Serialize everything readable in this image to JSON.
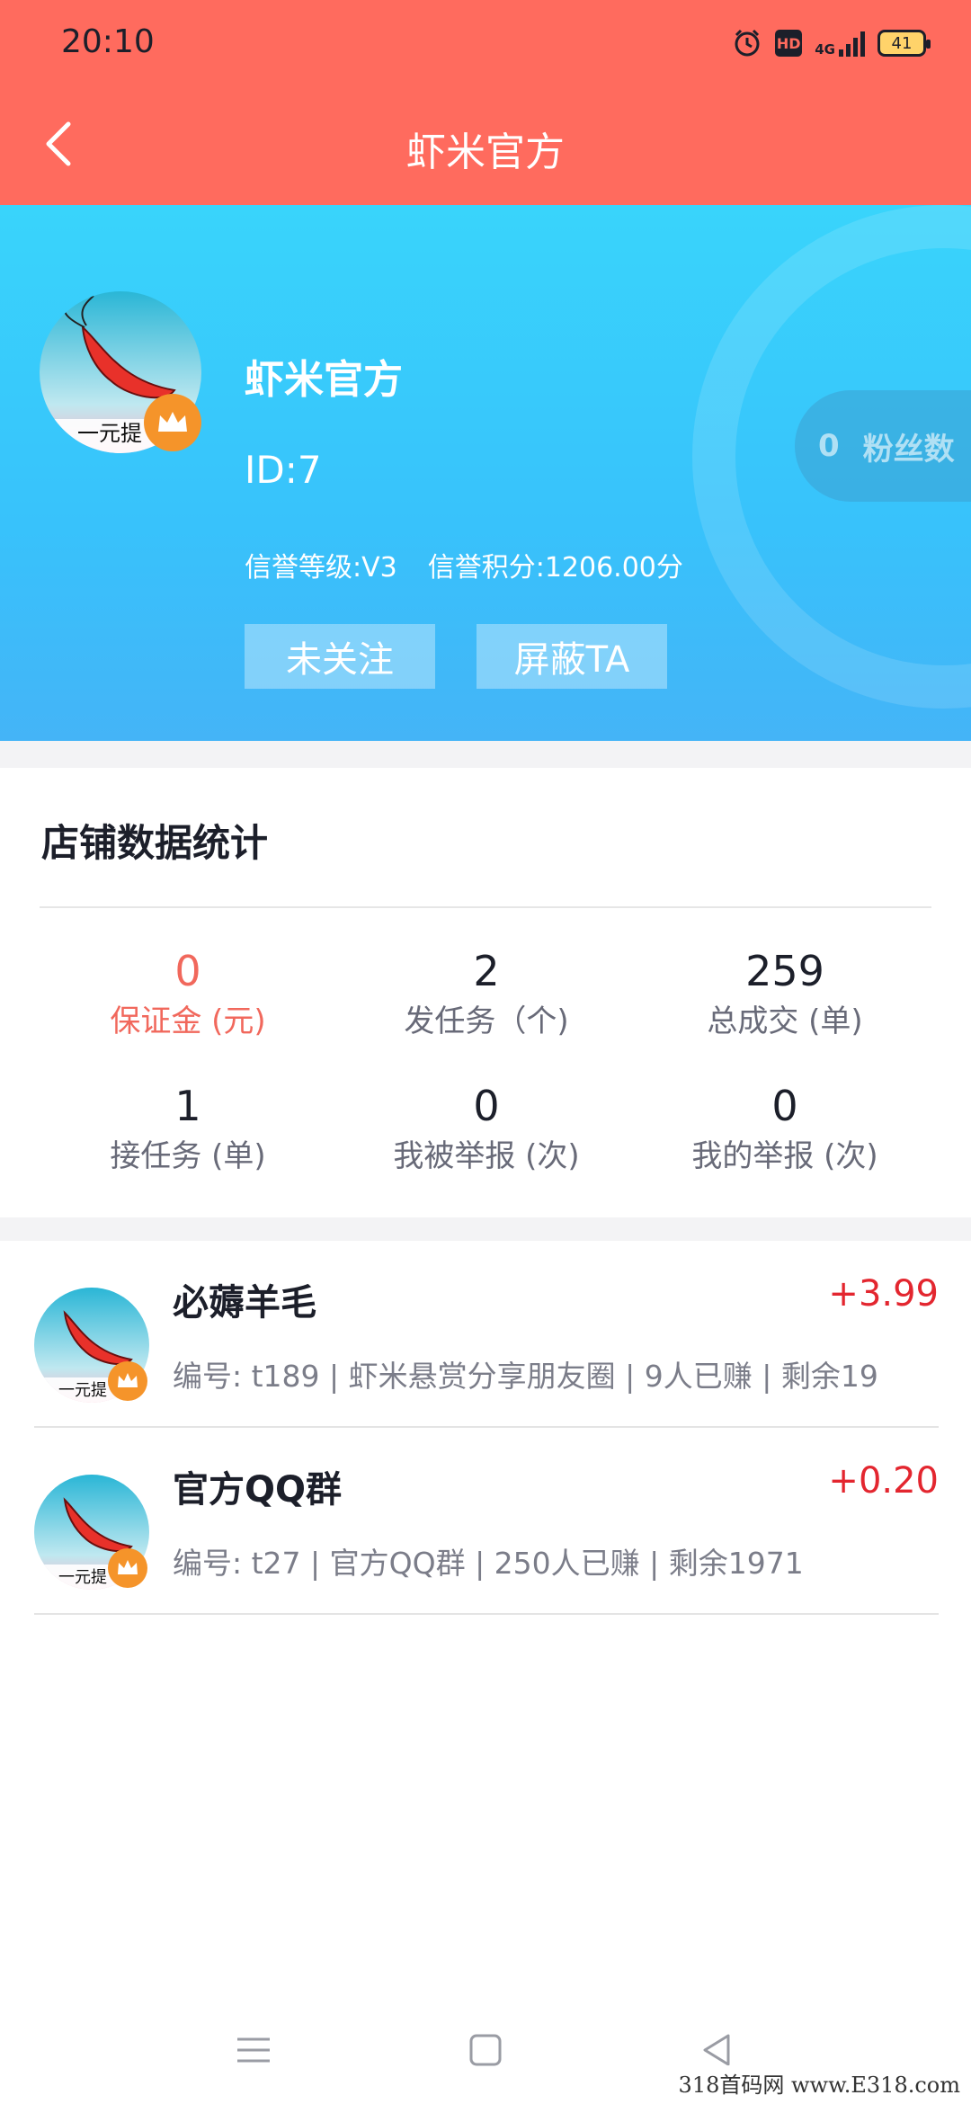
{
  "status_bar": {
    "time": "20:10",
    "battery": "41",
    "hd": "HD",
    "network": "4G"
  },
  "header": {
    "title": "虾米官方"
  },
  "profile": {
    "name": "虾米官方",
    "id_text": "ID:7",
    "credit_level": "信誉等级:V3",
    "credit_points": "信誉积分:1206.00分",
    "follow_label": "未关注",
    "block_label": "屏蔽TA",
    "fans_count": "0",
    "fans_label": "粉丝数",
    "avatar_caption": "一元提"
  },
  "stats": {
    "title": "店铺数据统计",
    "items": [
      {
        "value": "0",
        "label": "保证金 (元)"
      },
      {
        "value": "2",
        "label": "发任务（个)"
      },
      {
        "value": "259",
        "label": "总成交 (单)"
      },
      {
        "value": "1",
        "label": "接任务 (单)"
      },
      {
        "value": "0",
        "label": "我被举报 (次)"
      },
      {
        "value": "0",
        "label": "我的举报 (次)"
      }
    ]
  },
  "tasks": [
    {
      "name": "必薅羊毛",
      "amount": "+3.99",
      "meta": "编号: t189 | 虾米悬赏分享朋友圈 | 9人已赚 | 剩余19",
      "avatar_caption": "一元提"
    },
    {
      "name": "官方QQ群",
      "amount": "+0.20",
      "meta": "编号: t27 | 官方QQ群 | 250人已赚 | 剩余1971",
      "avatar_caption": "一元提"
    }
  ],
  "watermark": "318首码网  www.E318.com",
  "colors": {
    "topbar": "#ff6b5e",
    "header_gradient_top": "#39d4fb",
    "accent_red": "#f1685c",
    "amount_red": "#e3262f"
  }
}
